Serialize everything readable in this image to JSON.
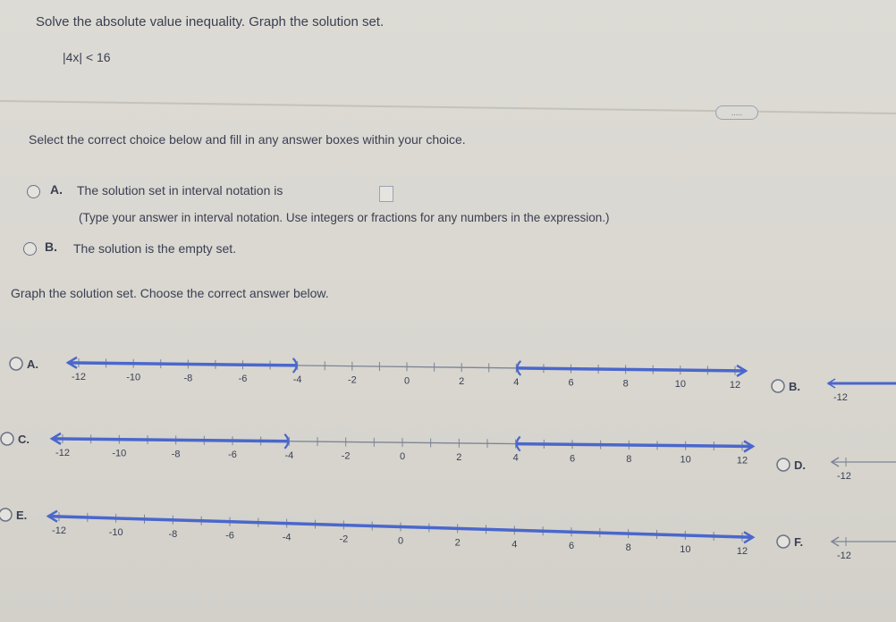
{
  "problem": {
    "prompt": "Solve the absolute value inequality. Graph the solution set.",
    "inequality": "|4x| < 16"
  },
  "more_button": {
    "label": "....."
  },
  "instructions": "Select the correct choice below and fill in any answer boxes within your choice.",
  "choices": [
    {
      "letter": "A.",
      "text": "The solution set in interval notation is",
      "hint": "(Type your answer in interval notation. Use integers or fractions for any numbers in the expression.)"
    },
    {
      "letter": "B.",
      "text": "The solution is the empty set."
    }
  ],
  "graph_prompt": "Graph the solution set. Choose the correct answer below.",
  "ticks": [
    "-12",
    "-10",
    "-8",
    "-6",
    "-4",
    "-2",
    "0",
    "2",
    "4",
    "6",
    "8",
    "10",
    "12"
  ],
  "graph_options": [
    {
      "letter": "A.",
      "shaded": "outside",
      "left_end": -4,
      "right_end": 4
    },
    {
      "letter": "B.",
      "partial_label": "-12"
    },
    {
      "letter": "C.",
      "shaded": "outside",
      "left_end": -4,
      "right_end": 4
    },
    {
      "letter": "D.",
      "partial_label": "-12"
    },
    {
      "letter": "E.",
      "shaded": "all"
    },
    {
      "letter": "F.",
      "partial_label": "-12"
    }
  ],
  "colors": {
    "line": "#4a67cc",
    "text": "#3a3f52",
    "axis": "#7d8496"
  }
}
